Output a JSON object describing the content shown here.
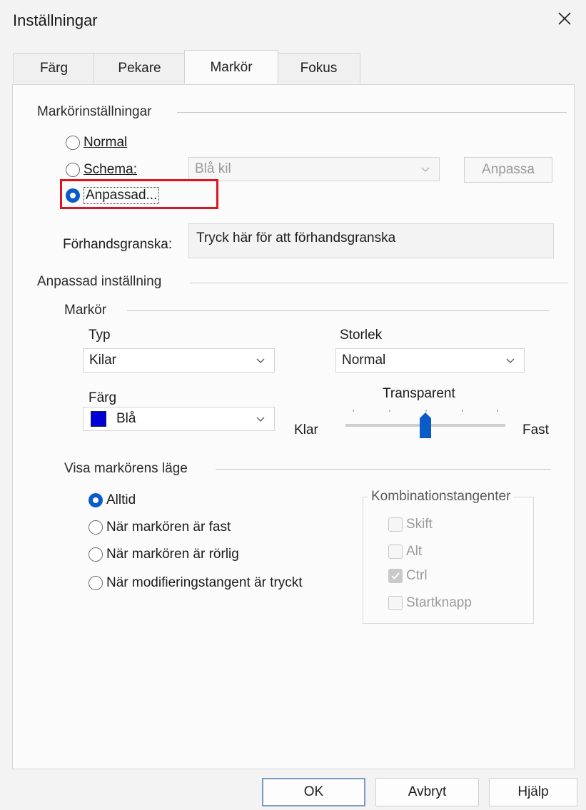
{
  "window": {
    "title": "Inställningar"
  },
  "tabs": [
    {
      "label": "Färg"
    },
    {
      "label": "Pekare"
    },
    {
      "label": "Markör"
    },
    {
      "label": "Fokus"
    }
  ],
  "cursor_settings": {
    "group_label": "Markörinställningar",
    "normal_label": "Normal",
    "scheme_label": "Schema:",
    "scheme_value": "Blå kil",
    "customize_button": "Anpassa",
    "custom_label": "Anpassad...",
    "selected": "Anpassad...",
    "preview_label": "Förhandsgranska:",
    "preview_text": "Tryck här för att förhandsgranska"
  },
  "custom_setting": {
    "group_label": "Anpassad inställning",
    "cursor_group_label": "Markör",
    "type_label": "Typ",
    "type_value": "Kilar",
    "size_label": "Storlek",
    "size_value": "Normal",
    "color_label": "Färg",
    "color_value": "Blå",
    "color_swatch": "#0000d6",
    "transparent_label": "Transparent",
    "transparent_left": "Klar",
    "transparent_right": "Fast",
    "transparency_level": 0.5
  },
  "show_location": {
    "group_label": "Visa markörens läge",
    "options": [
      {
        "label": "Alltid",
        "selected": true
      },
      {
        "label": "När markören är fast",
        "selected": false
      },
      {
        "label": "När markören är rörlig",
        "selected": false
      },
      {
        "label": "När modifieringstangent är tryckt",
        "selected": false
      }
    ]
  },
  "modifier_keys": {
    "group_label": "Kombinationstangenter",
    "keys": [
      {
        "label": "Skift",
        "checked": false
      },
      {
        "label": "Alt",
        "checked": false
      },
      {
        "label": "Ctrl",
        "checked": true
      },
      {
        "label": "Startknapp",
        "checked": false
      }
    ]
  },
  "footer": {
    "ok": "OK",
    "cancel": "Avbryt",
    "help": "Hjälp"
  },
  "colors": {
    "accent": "#0a5bc8",
    "highlight_box": "#e0141e"
  }
}
